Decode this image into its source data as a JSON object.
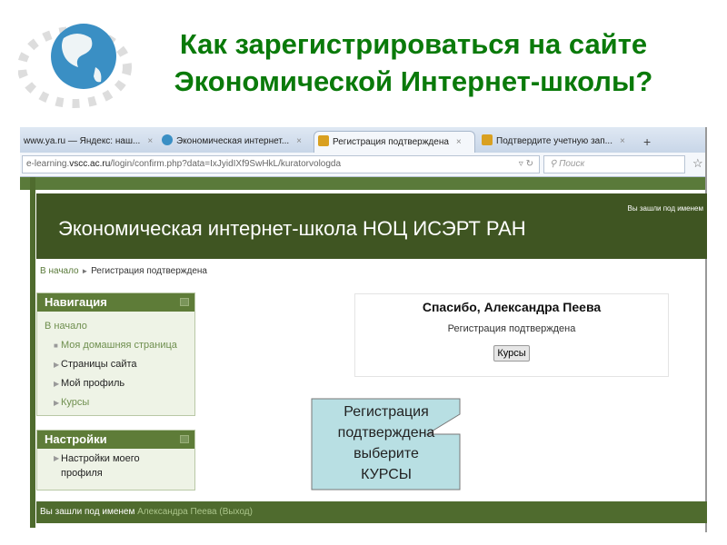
{
  "slide": {
    "title_line1": "Как зарегистрироваться на сайте",
    "title_line2": "Экономической Интернет-школы?"
  },
  "browser": {
    "tabs": [
      {
        "label": "www.ya.ru — Яндекс: наш..."
      },
      {
        "label": "Экономическая интернет..."
      },
      {
        "label": "Регистрация подтверждена",
        "active": true
      },
      {
        "label": "Подтвердите учетную зап..."
      }
    ],
    "tab_close": "×",
    "new_tab": "+",
    "url_pre": "e-learning.",
    "url_domain": "vscc.ac.ru",
    "url_path": "/login/confirm.php?data=IxJyidIXf9SwHkL/kuratorvologda",
    "search_placeholder": "Поиск"
  },
  "page": {
    "site_name": "Экономическая интернет-школа НОЦ ИСЭРТ РАН",
    "header_login": "Вы зашли под именем",
    "breadcrumb": {
      "home": "В начало",
      "sep": "►",
      "current": "Регистрация подтверждена"
    },
    "nav": {
      "title": "Навигация",
      "home": "В начало",
      "items": [
        "Моя домашняя страница",
        "Страницы сайта",
        "Мой профиль",
        "Курсы"
      ]
    },
    "settings": {
      "title": "Настройки",
      "items": [
        "Настройки моего профиля"
      ]
    },
    "content": {
      "heading": "Спасибо, Александра Пеева",
      "message": "Регистрация подтверждена",
      "button": "Курсы"
    },
    "footer": {
      "prefix": "Вы зашли под именем",
      "user": "Александра Пеева",
      "logout": "(Выход)"
    }
  },
  "callout": {
    "lines": [
      "Регистрация",
      "подтверждена",
      "выберите",
      "КУРСЫ"
    ]
  }
}
